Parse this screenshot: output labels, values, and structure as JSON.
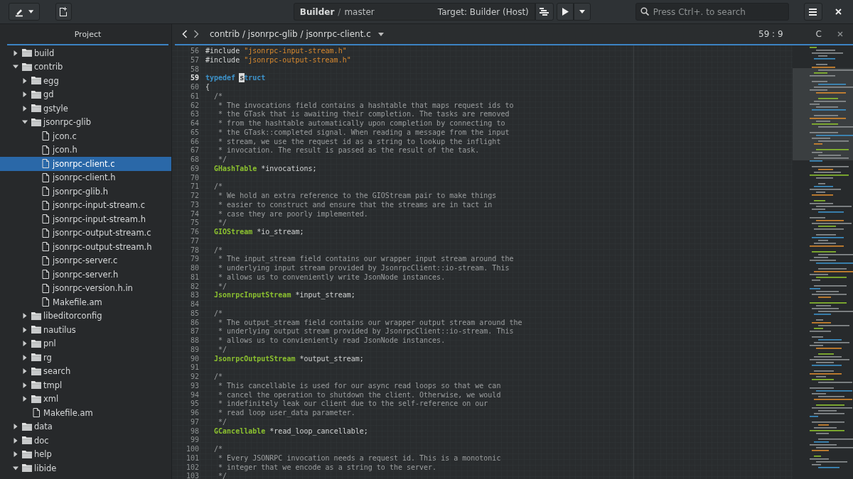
{
  "header": {
    "title": "Builder",
    "separator": "/",
    "branch": "master",
    "target": "Target: Builder (Host)",
    "search": {
      "placeholder": "Press Ctrl+. to search"
    }
  },
  "sidebar": {
    "title": "Project",
    "tree": [
      {
        "label": "build",
        "kind": "folder",
        "expanded": false,
        "selected": false
      },
      {
        "label": "contrib",
        "kind": "folder",
        "expanded": true,
        "selected": false,
        "children": [
          {
            "label": "egg",
            "kind": "folder",
            "expanded": false,
            "selected": false
          },
          {
            "label": "gd",
            "kind": "folder",
            "expanded": false,
            "selected": false
          },
          {
            "label": "gstyle",
            "kind": "folder",
            "expanded": false,
            "selected": false
          },
          {
            "label": "jsonrpc-glib",
            "kind": "folder",
            "expanded": true,
            "selected": false,
            "children": [
              {
                "label": "jcon.c",
                "kind": "file",
                "selected": false
              },
              {
                "label": "jcon.h",
                "kind": "file",
                "selected": false
              },
              {
                "label": "jsonrpc-client.c",
                "kind": "file",
                "selected": true
              },
              {
                "label": "jsonrpc-client.h",
                "kind": "file",
                "selected": false
              },
              {
                "label": "jsonrpc-glib.h",
                "kind": "file",
                "selected": false
              },
              {
                "label": "jsonrpc-input-stream.c",
                "kind": "file",
                "selected": false
              },
              {
                "label": "jsonrpc-input-stream.h",
                "kind": "file",
                "selected": false
              },
              {
                "label": "jsonrpc-output-stream.c",
                "kind": "file",
                "selected": false
              },
              {
                "label": "jsonrpc-output-stream.h",
                "kind": "file",
                "selected": false
              },
              {
                "label": "jsonrpc-server.c",
                "kind": "file",
                "selected": false
              },
              {
                "label": "jsonrpc-server.h",
                "kind": "file",
                "selected": false
              },
              {
                "label": "jsonrpc-version.h.in",
                "kind": "file",
                "selected": false
              },
              {
                "label": "Makefile.am",
                "kind": "file",
                "selected": false
              }
            ]
          },
          {
            "label": "libeditorconfig",
            "kind": "folder",
            "expanded": false,
            "selected": false
          },
          {
            "label": "nautilus",
            "kind": "folder",
            "expanded": false,
            "selected": false
          },
          {
            "label": "pnl",
            "kind": "folder",
            "expanded": false,
            "selected": false
          },
          {
            "label": "rg",
            "kind": "folder",
            "expanded": false,
            "selected": false
          },
          {
            "label": "search",
            "kind": "folder",
            "expanded": false,
            "selected": false
          },
          {
            "label": "tmpl",
            "kind": "folder",
            "expanded": false,
            "selected": false
          },
          {
            "label": "xml",
            "kind": "folder",
            "expanded": false,
            "selected": false
          },
          {
            "label": "Makefile.am",
            "kind": "file",
            "selected": false
          }
        ]
      },
      {
        "label": "data",
        "kind": "folder",
        "expanded": false,
        "selected": false
      },
      {
        "label": "doc",
        "kind": "folder",
        "expanded": false,
        "selected": false
      },
      {
        "label": "help",
        "kind": "folder",
        "expanded": false,
        "selected": false
      },
      {
        "label": "libide",
        "kind": "folder",
        "expanded": true,
        "selected": false
      }
    ]
  },
  "editor": {
    "path": "contrib / jsonrpc-glib / jsonrpc-client.c",
    "position": "59 : 9",
    "language": "C",
    "lines": [
      {
        "number": "56",
        "current": false,
        "tokens": [
          {
            "kind": "plain",
            "text": "#include "
          },
          {
            "kind": "string",
            "text": "\"jsonrpc-input-stream.h\""
          }
        ]
      },
      {
        "number": "57",
        "current": false,
        "tokens": [
          {
            "kind": "plain",
            "text": "#include "
          },
          {
            "kind": "string",
            "text": "\"jsonrpc-output-stream.h\""
          }
        ]
      },
      {
        "number": "58",
        "current": false
      },
      {
        "number": "59",
        "current": true,
        "tokens": [
          {
            "kind": "keyword",
            "text": "typedef "
          },
          {
            "kind": "cursor",
            "text": "s"
          },
          {
            "kind": "keyword",
            "text": "truct"
          }
        ]
      },
      {
        "number": "60",
        "current": false,
        "tokens": [
          {
            "kind": "plain",
            "text": "{"
          }
        ]
      },
      {
        "number": "61",
        "current": false,
        "tokens": [
          {
            "kind": "comment",
            "text": "  /*"
          }
        ]
      },
      {
        "number": "62",
        "current": false,
        "tokens": [
          {
            "kind": "comment",
            "text": "   * The invocations field contains a hashtable that maps request ids to"
          }
        ]
      },
      {
        "number": "63",
        "current": false,
        "tokens": [
          {
            "kind": "comment",
            "text": "   * the GTask that is awaiting their completion. The tasks are removed"
          }
        ]
      },
      {
        "number": "64",
        "current": false,
        "tokens": [
          {
            "kind": "comment",
            "text": "   * from the hashtable automatically upon completion by connecting to"
          }
        ]
      },
      {
        "number": "65",
        "current": false,
        "tokens": [
          {
            "kind": "comment",
            "text": "   * the GTask::completed signal. When reading a message from the input"
          }
        ]
      },
      {
        "number": "66",
        "current": false,
        "tokens": [
          {
            "kind": "comment",
            "text": "   * stream, we use the request id as a string to lookup the inflight"
          }
        ]
      },
      {
        "number": "67",
        "current": false,
        "tokens": [
          {
            "kind": "comment",
            "text": "   * invocation. The result is passed as the result of the task."
          }
        ]
      },
      {
        "number": "68",
        "current": false,
        "tokens": [
          {
            "kind": "comment",
            "text": "   */"
          }
        ]
      },
      {
        "number": "69",
        "current": false,
        "tokens": [
          {
            "kind": "type",
            "text": "  GHashTable"
          },
          {
            "kind": "plain",
            "text": " *invocations;"
          }
        ]
      },
      {
        "number": "70",
        "current": false
      },
      {
        "number": "71",
        "current": false,
        "tokens": [
          {
            "kind": "comment",
            "text": "  /*"
          }
        ]
      },
      {
        "number": "72",
        "current": false,
        "tokens": [
          {
            "kind": "comment",
            "text": "   * We hold an extra reference to the GIOStream pair to make things"
          }
        ]
      },
      {
        "number": "73",
        "current": false,
        "tokens": [
          {
            "kind": "comment",
            "text": "   * easier to construct and ensure that the streams are in tact in"
          }
        ]
      },
      {
        "number": "74",
        "current": false,
        "tokens": [
          {
            "kind": "comment",
            "text": "   * case they are poorly implemented."
          }
        ]
      },
      {
        "number": "75",
        "current": false,
        "tokens": [
          {
            "kind": "comment",
            "text": "   */"
          }
        ]
      },
      {
        "number": "76",
        "current": false,
        "tokens": [
          {
            "kind": "type",
            "text": "  GIOStream"
          },
          {
            "kind": "plain",
            "text": " *io_stream;"
          }
        ]
      },
      {
        "number": "77",
        "current": false
      },
      {
        "number": "78",
        "current": false,
        "tokens": [
          {
            "kind": "comment",
            "text": "  /*"
          }
        ]
      },
      {
        "number": "79",
        "current": false,
        "tokens": [
          {
            "kind": "comment",
            "text": "   * The input_stream field contains our wrapper input stream around the"
          }
        ]
      },
      {
        "number": "80",
        "current": false,
        "tokens": [
          {
            "kind": "comment",
            "text": "   * underlying input stream provided by JsonrpcClient::io-stream. This"
          }
        ]
      },
      {
        "number": "81",
        "current": false,
        "tokens": [
          {
            "kind": "comment",
            "text": "   * allows us to conveniently write JsonNode instances."
          }
        ]
      },
      {
        "number": "82",
        "current": false,
        "tokens": [
          {
            "kind": "comment",
            "text": "   */"
          }
        ]
      },
      {
        "number": "83",
        "current": false,
        "tokens": [
          {
            "kind": "type",
            "text": "  JsonrpcInputStream"
          },
          {
            "kind": "plain",
            "text": " *input_stream;"
          }
        ]
      },
      {
        "number": "84",
        "current": false
      },
      {
        "number": "85",
        "current": false,
        "tokens": [
          {
            "kind": "comment",
            "text": "  /*"
          }
        ]
      },
      {
        "number": "86",
        "current": false,
        "tokens": [
          {
            "kind": "comment",
            "text": "   * The output_stream field contains our wrapper output stream around the"
          }
        ]
      },
      {
        "number": "87",
        "current": false,
        "tokens": [
          {
            "kind": "comment",
            "text": "   * underlying output stream provided by JsonrpcClient::io-stream. This"
          }
        ]
      },
      {
        "number": "88",
        "current": false,
        "tokens": [
          {
            "kind": "comment",
            "text": "   * allows us to convieniently read JsonNode instances."
          }
        ]
      },
      {
        "number": "89",
        "current": false,
        "tokens": [
          {
            "kind": "comment",
            "text": "   */"
          }
        ]
      },
      {
        "number": "90",
        "current": false,
        "tokens": [
          {
            "kind": "type",
            "text": "  JsonrpcOutputStream"
          },
          {
            "kind": "plain",
            "text": " *output_stream;"
          }
        ]
      },
      {
        "number": "91",
        "current": false
      },
      {
        "number": "92",
        "current": false,
        "tokens": [
          {
            "kind": "comment",
            "text": "  /*"
          }
        ]
      },
      {
        "number": "93",
        "current": false,
        "tokens": [
          {
            "kind": "comment",
            "text": "   * This cancellable is used for our async read loops so that we can"
          }
        ]
      },
      {
        "number": "94",
        "current": false,
        "tokens": [
          {
            "kind": "comment",
            "text": "   * cancel the operation to shutdown the client. Otherwise, we would"
          }
        ]
      },
      {
        "number": "95",
        "current": false,
        "tokens": [
          {
            "kind": "comment",
            "text": "   * indefinitely leak our client due to the self-reference on our"
          }
        ]
      },
      {
        "number": "96",
        "current": false,
        "tokens": [
          {
            "kind": "comment",
            "text": "   * read loop user_data parameter."
          }
        ]
      },
      {
        "number": "97",
        "current": false,
        "tokens": [
          {
            "kind": "comment",
            "text": "   */"
          }
        ]
      },
      {
        "number": "98",
        "current": false,
        "tokens": [
          {
            "kind": "type",
            "text": "  GCancellable"
          },
          {
            "kind": "plain",
            "text": " *read_loop_cancellable;"
          }
        ]
      },
      {
        "number": "99",
        "current": false
      },
      {
        "number": "100",
        "current": false,
        "tokens": [
          {
            "kind": "comment",
            "text": "  /*"
          }
        ]
      },
      {
        "number": "101",
        "current": false,
        "tokens": [
          {
            "kind": "comment",
            "text": "   * Every JSONRPC invocation needs a request id. This is a monotonic"
          }
        ]
      },
      {
        "number": "102",
        "current": false,
        "tokens": [
          {
            "kind": "comment",
            "text": "   * integer that we encode as a string to the server."
          }
        ]
      },
      {
        "number": "103",
        "current": false,
        "tokens": [
          {
            "kind": "comment",
            "text": "   */"
          }
        ]
      }
    ]
  }
}
